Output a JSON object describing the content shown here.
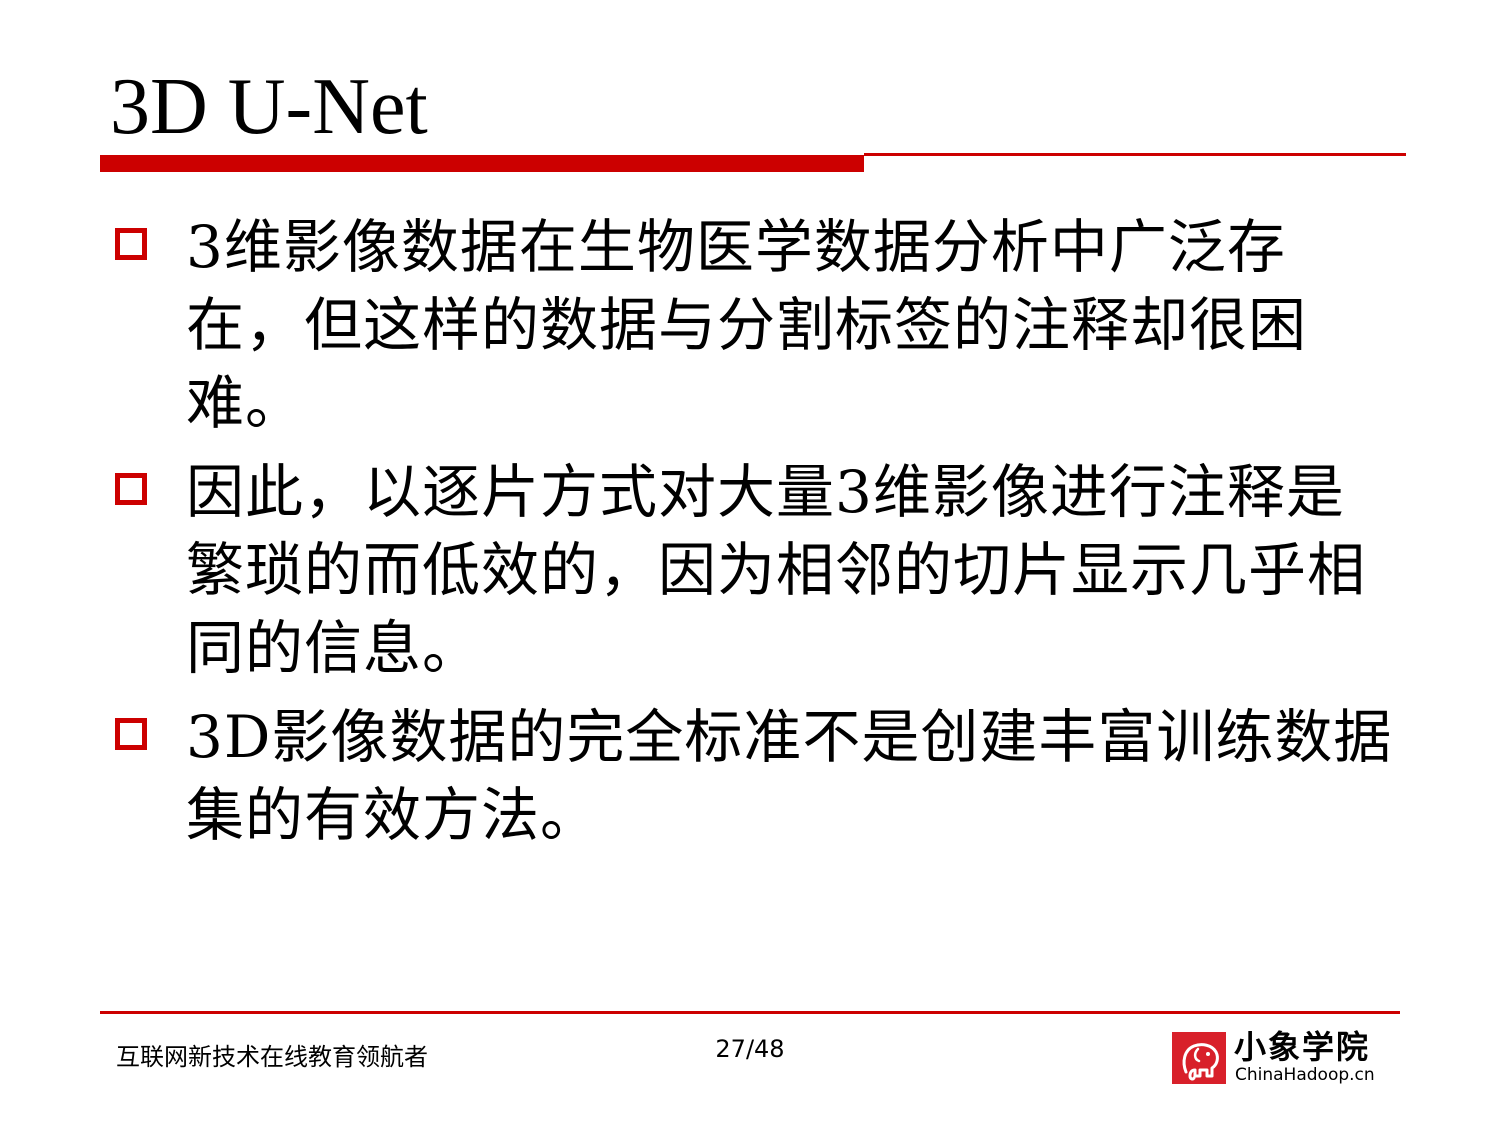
{
  "slide": {
    "title": "3D U-Net",
    "bullets": [
      "3维影像数据在生物医学数据分析中广泛存在，但这样的数据与分割标签的注释却很困难。",
      "因此，以逐片方式对大量3维影像进行注释是繁琐的而低效的，因为相邻的切片显示几乎相同的信息。",
      "3D影像数据的完全标准不是创建丰富训练数据集的有效方法。"
    ]
  },
  "footer": {
    "slogan": "互联网新技术在线教育领航者",
    "page_number": "27/48",
    "logo_name": "小象学院",
    "logo_domain": "ChinaHadoop.cn"
  },
  "colors": {
    "accent": "#cc0000",
    "text": "#000000",
    "background": "#ffffff"
  },
  "icons": {
    "bullet": "hollow-square",
    "logo": "elephant-logo"
  }
}
